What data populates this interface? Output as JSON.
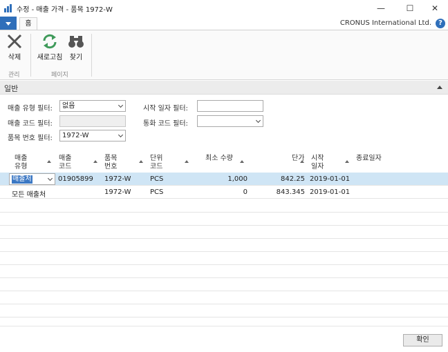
{
  "window": {
    "title": "수정 - 매출 가격 - 품목 1972-W",
    "minimize": "—",
    "maximize": "☐",
    "close": "✕"
  },
  "ribbon": {
    "tab_home": "홈",
    "company": "CRONUS International Ltd.",
    "help": "?",
    "delete_label": "삭제",
    "refresh_label": "새로고침",
    "find_label": "찾기",
    "group_manage": "관리",
    "group_page": "페이지"
  },
  "section": {
    "title": "일반"
  },
  "filters": {
    "sales_type_label": "매출 유형 필터:",
    "sales_type_value": "없음",
    "sales_code_label": "매출 코드 필터:",
    "sales_code_value": "",
    "item_no_label": "품목 번호 필터:",
    "item_no_value": "1972-W",
    "start_date_label": "시작 일자 필터:",
    "start_date_value": "",
    "currency_label": "통화 코드 필터:",
    "currency_value": ""
  },
  "grid": {
    "headers": {
      "sales_type_1": "매출",
      "sales_type_2": "유형",
      "sales_code_1": "매출",
      "sales_code_2": "코드",
      "item_no_1": "품목",
      "item_no_2": "번호",
      "uom_1": "단위",
      "uom_2": "코드",
      "min_qty": "최소 수량",
      "unit_price": "단가",
      "start_date_1": "시작",
      "start_date_2": "일자",
      "end_date": "종료일자"
    },
    "rows": [
      {
        "sales_type": "매출처",
        "sales_code": "01905899",
        "item_no": "1972-W",
        "uom": "PCS",
        "min_qty": "1,000",
        "unit_price": "842.25",
        "start_date": "2019-01-01",
        "end_date": ""
      },
      {
        "sales_type": "모든 매출처",
        "sales_code": "",
        "item_no": "1972-W",
        "uom": "PCS",
        "min_qty": "0",
        "unit_price": "843.345",
        "start_date": "2019-01-01",
        "end_date": ""
      }
    ]
  },
  "footer": {
    "ok_label": "확인"
  },
  "colors": {
    "accent": "#2f6fba",
    "selected_row": "#cfe5f5",
    "highlight": "#3b78c4"
  }
}
